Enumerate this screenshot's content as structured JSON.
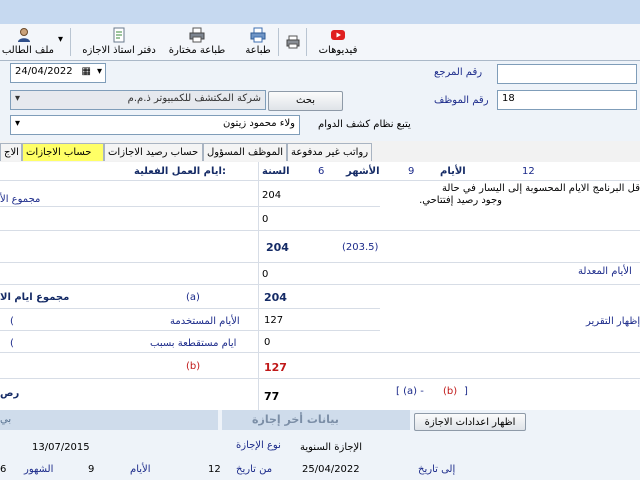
{
  "toolbar": {
    "videos": "فيديوهات",
    "print": "طباعة",
    "print_selected": "طباعة مختارة",
    "leave_book": "دفتر استاذ الاجازه",
    "employee_file": "ملف الطالب"
  },
  "form": {
    "ref_label": "رقم المرجع",
    "ref_value": "",
    "emp_label": "رقم الموظف",
    "emp_value": "18",
    "date_value": "24/04/2022",
    "search_button": "بحث",
    "company_value": "شركة المكتشف للكمبيوتر ذ.م.م",
    "employee_name_value": "ولاء محمود زيتون",
    "attendance_label": "يتبع نظام كشف الدوام"
  },
  "tabs": [
    "رواتب غير مدفوعة",
    "الموظف المسؤول",
    "حساب رصيد الاجازات",
    "حساب الاجازات",
    "الاج"
  ],
  "panel": {
    "hdr_days": "الأيام",
    "hdr_days_val": "12",
    "hdr_months": "الأشهر",
    "hdr_months_val": "9",
    "hdr_year": "السنة",
    "hdr_year_val": "6",
    "hdr_actual": "ايام العمل الفعلية:",
    "note_line1": "قل البرنامج الايام المحسوبة إلى اليسار في حالة",
    "note_line2": "وجود رصيد إفتتاحي.",
    "total_label": "مجموع الأ",
    "val_204a": "204",
    "val_0a": "0",
    "val_204b": "204",
    "val_203_5": "(203.5)",
    "adjusted_label": "الأيام المعدلة",
    "val_0b": "0",
    "total_days_label": "مجموع ايام الا",
    "tag_a": "(a)",
    "val_204c": "204",
    "used_days_label": "الأيام المستخدمة",
    "used_mark": "(",
    "val_127a": "127",
    "show_report": "إظهار التقرير",
    "deducted_label": "ايام مستقطعة بسبب",
    "deducted_mark": "(",
    "val_0c": "0",
    "tag_b": "(b)",
    "val_127b": "127",
    "balance_label": "رص",
    "val_77": "77",
    "formula_open": "[ (a) -",
    "formula_b": "(b)",
    "formula_close": "]"
  },
  "bottom": {
    "show_settings_button": "اظهار اعدادات الاجازة",
    "last_leave_header": "بيانات أخر إجازة",
    "left_header": "بي",
    "date_1": "13/07/2015",
    "leave_type_label": "نوع الإجازة",
    "leave_type_value": "الإجازة السنوية",
    "months_label": "الشهور",
    "months_val": "9",
    "days_label": "الأيام",
    "days_val": "12",
    "prefix_num": "6",
    "from_label": "من تاريخ",
    "from_value": "25/04/2022",
    "to_label": "إلى تاريخ"
  }
}
